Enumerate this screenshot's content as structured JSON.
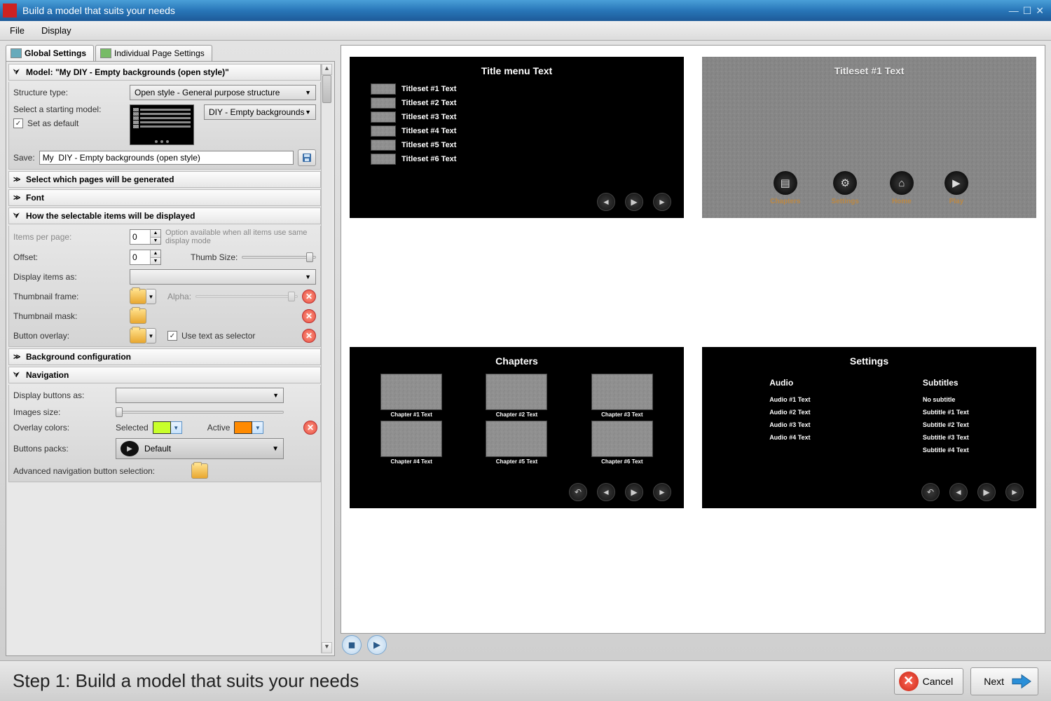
{
  "window": {
    "title": "Build a model that suits your needs"
  },
  "menu": {
    "file": "File",
    "display": "Display"
  },
  "tabs": {
    "global": "Global Settings",
    "individual": "Individual Page Settings"
  },
  "sections": {
    "model": {
      "header": "Model: \"My  DIY - Empty backgrounds (open style)\"",
      "structure_label": "Structure type:",
      "structure_value": "Open style - General purpose structure",
      "starting_label": "Select a starting model:",
      "set_default_label": "Set as default",
      "set_default_checked": true,
      "starting_value": "DIY - Empty backgrounds",
      "save_label": "Save:",
      "save_value": "My  DIY - Empty backgrounds (open style)"
    },
    "pages": {
      "header": "Select which pages will be generated"
    },
    "font": {
      "header": "Font"
    },
    "display": {
      "header": "How the selectable items will be displayed",
      "items_per_page_label": "Items per page:",
      "items_per_page_value": "0",
      "items_per_page_hint": "Option available when all items use same display mode",
      "offset_label": "Offset:",
      "offset_value": "0",
      "thumb_size_label": "Thumb Size:",
      "display_items_label": "Display items as:",
      "display_items_value": "",
      "thumb_frame_label": "Thumbnail frame:",
      "alpha_label": "Alpha:",
      "thumb_mask_label": "Thumbnail mask:",
      "button_overlay_label": "Button overlay:",
      "use_text_selector_label": "Use text as selector",
      "use_text_selector_checked": true
    },
    "background": {
      "header": "Background configuration"
    },
    "navigation": {
      "header": "Navigation",
      "display_buttons_label": "Display buttons as:",
      "display_buttons_value": "",
      "images_size_label": "Images size:",
      "overlay_colors_label": "Overlay colors:",
      "selected_label": "Selected",
      "active_label": "Active",
      "buttons_packs_label": "Buttons packs:",
      "buttons_packs_value": "Default",
      "adv_nav_label": "Advanced navigation button selection:"
    }
  },
  "preview": {
    "title_menu": {
      "title": "Title menu Text",
      "items": [
        "Titleset #1 Text",
        "Titleset #2 Text",
        "Titleset #3 Text",
        "Titleset #4 Text",
        "Titleset #5 Text",
        "Titleset #6 Text"
      ]
    },
    "titleset": {
      "title": "Titleset #1 Text",
      "buttons": [
        {
          "icon": "book",
          "label": "Chapters"
        },
        {
          "icon": "gear",
          "label": "Settings"
        },
        {
          "icon": "home",
          "label": "Home"
        },
        {
          "icon": "play",
          "label": "Play"
        }
      ]
    },
    "chapters": {
      "title": "Chapters",
      "items": [
        "Chapter #1 Text",
        "Chapter #2 Text",
        "Chapter #3 Text",
        "Chapter #4 Text",
        "Chapter #5 Text",
        "Chapter #6 Text"
      ]
    },
    "settings": {
      "title": "Settings",
      "audio_header": "Audio",
      "subtitles_header": "Subtitles",
      "audio": [
        "Audio #1 Text",
        "Audio #2 Text",
        "Audio #3 Text",
        "Audio #4 Text"
      ],
      "subtitles": [
        "No subtitle",
        "Subtitle #1 Text",
        "Subtitle #2 Text",
        "Subtitle #3 Text",
        "Subtitle #4 Text"
      ]
    }
  },
  "footer": {
    "step": "Step 1: Build a model that suits your needs",
    "cancel": "Cancel",
    "next": "Next"
  },
  "colors": {
    "selected": "#c8ff2a",
    "active": "#ff8a00"
  }
}
